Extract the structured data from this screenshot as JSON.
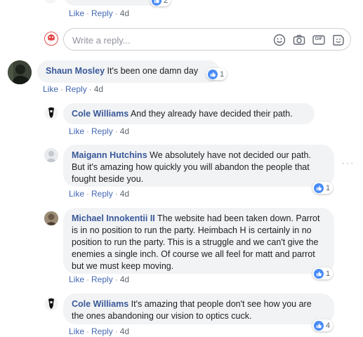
{
  "colors": {
    "author": "#385898",
    "link": "#4267b2",
    "bubble": "#f2f3f5",
    "like": "#4a8cf7"
  },
  "top_comment": {
    "like_label": "Like",
    "reply_label": "Reply",
    "time": "4d",
    "reaction_count": "2"
  },
  "reply_box": {
    "placeholder": "Write a reply...",
    "icons": [
      "smiley-icon",
      "camera-icon",
      "gif-icon",
      "sticker-icon"
    ],
    "gif_label": "GIF"
  },
  "comments": [
    {
      "author": "Shaun Mosley",
      "text": "It's been one damn day",
      "like_label": "Like",
      "reply_label": "Reply",
      "time": "4d",
      "reaction_count": "1"
    },
    {
      "author": "Cole Williams",
      "text": "And they already have decided their path.",
      "like_label": "Like",
      "reply_label": "Reply",
      "time": "4d"
    },
    {
      "author": "Maigann Hutchins",
      "text": "We absolutely have not decided our path. But it's amazing how quickly you will abandon the people that fought beside you.",
      "like_label": "Like",
      "reply_label": "Reply",
      "time": "4d",
      "reaction_count": "1"
    },
    {
      "author": "Michael Innokentii II",
      "text": "The website had been taken down. Parrot is in no position to run the party. Heimbach H is certainly in no position to run the party. This is a struggle and we can't give the enemies a single inch. Of course we all feel for matt and parrot but we must keep moving.",
      "like_label": "Like",
      "reply_label": "Reply",
      "time": "4d",
      "reaction_count": "1"
    },
    {
      "author": "Cole Williams",
      "text": "It's amazing that people don't see how you are the ones abandoning our vision to optics cuck.",
      "like_label": "Like",
      "reply_label": "Reply",
      "time": "4d",
      "reaction_count": "4"
    }
  ],
  "more_options": "···"
}
